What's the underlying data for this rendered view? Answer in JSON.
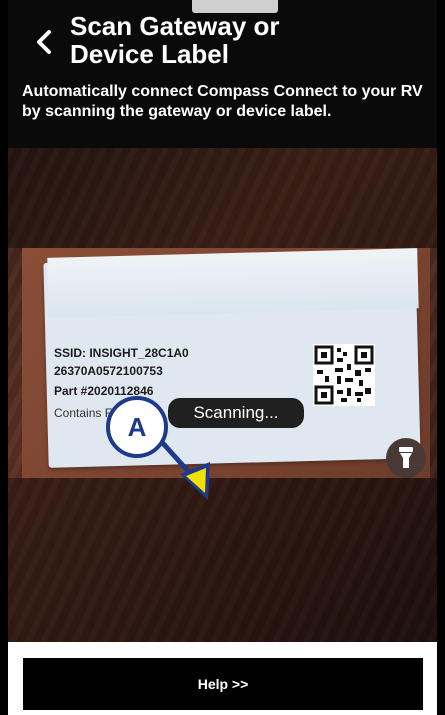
{
  "header": {
    "title": "Scan Gateway or\nDevice Label",
    "description": "Automatically connect Compass Connect to your RV by scanning the gateway or device label."
  },
  "camera": {
    "label_lines": {
      "ssid": "SSID: INSIGHT_28C1A0",
      "serial": "26370A0572100753",
      "part": "Part #2020112846",
      "fcc": "Contains FCC I"
    },
    "status": "Scanning..."
  },
  "callout": {
    "letter": "A"
  },
  "footer": {
    "help_label": "Help >>"
  },
  "icons": [
    "chevron-left-icon",
    "flashlight-icon",
    "qr-code-icon",
    "arrow-icon"
  ],
  "colors": {
    "header_bg": "#0a0a0a",
    "callout_border": "#1e3a8a",
    "arrow_fill": "#f2e000"
  }
}
